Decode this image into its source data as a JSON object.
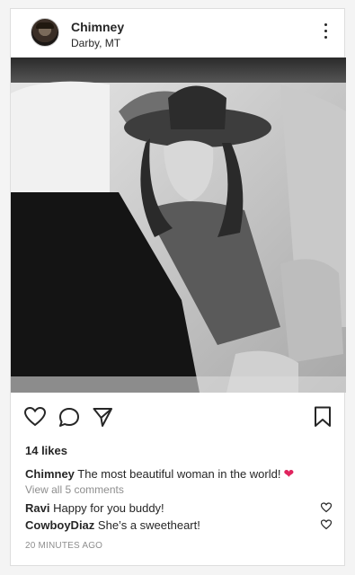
{
  "post": {
    "username": "Chimney",
    "location": "Darby, MT",
    "likes": "14 likes",
    "caption_user": "Chimney",
    "caption_text": "The most beautiful woman in the world!",
    "caption_emoji": "❤",
    "view_all": "View all 5 comments",
    "comments": [
      {
        "user": "Ravi",
        "text": "Happy for you buddy!"
      },
      {
        "user": "CowboyDiaz",
        "text": "She’s a sweetheart!"
      }
    ],
    "timestamp": "20 MINUTES AGO"
  },
  "icons": {
    "more": "more-options-icon",
    "like": "heart-icon",
    "comment": "comment-icon",
    "share": "share-icon",
    "save": "bookmark-icon"
  },
  "colors": {
    "text": "#262626",
    "muted": "#8e8e8e",
    "heart": "#e0245e"
  }
}
